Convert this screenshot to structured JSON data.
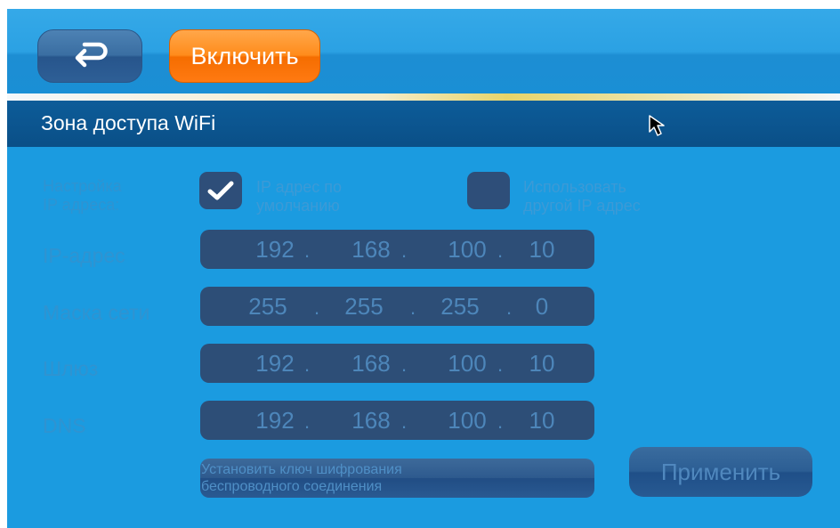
{
  "toolbar": {
    "back_icon": "back-arrow-icon",
    "enable_label": "Включить"
  },
  "section": {
    "title": "Зона доступа WiFi"
  },
  "ip_settings": {
    "label_line1": "Настройка",
    "label_line2": "IP адреса:",
    "default_ip": {
      "checked": true,
      "line1": "IP адрес по",
      "line2": "умолчанию"
    },
    "other_ip": {
      "checked": false,
      "line1": "Использовать",
      "line2": "другой IP адрес"
    }
  },
  "fields": {
    "ip": {
      "label": "IP-адрес",
      "octets": [
        "192",
        "168",
        "100",
        "10"
      ]
    },
    "mask": {
      "label": "Маска сети",
      "octets": [
        "255",
        "255",
        "255",
        "0"
      ]
    },
    "gateway": {
      "label": "Шлюз",
      "octets": [
        "192",
        "168",
        "100",
        "10"
      ]
    },
    "dns": {
      "label": "DNS",
      "octets": [
        "192",
        "168",
        "100",
        "10"
      ]
    }
  },
  "separator": ".",
  "actions": {
    "key_line1": "Установить ключ шифрования",
    "key_line2": "беспроводного соединения",
    "apply_label": "Применить"
  },
  "colors": {
    "background": "#1b9be0",
    "section_bar": "#0b5490",
    "enable_button": "#ff8a1a",
    "field_bg": "#2d4e77"
  }
}
